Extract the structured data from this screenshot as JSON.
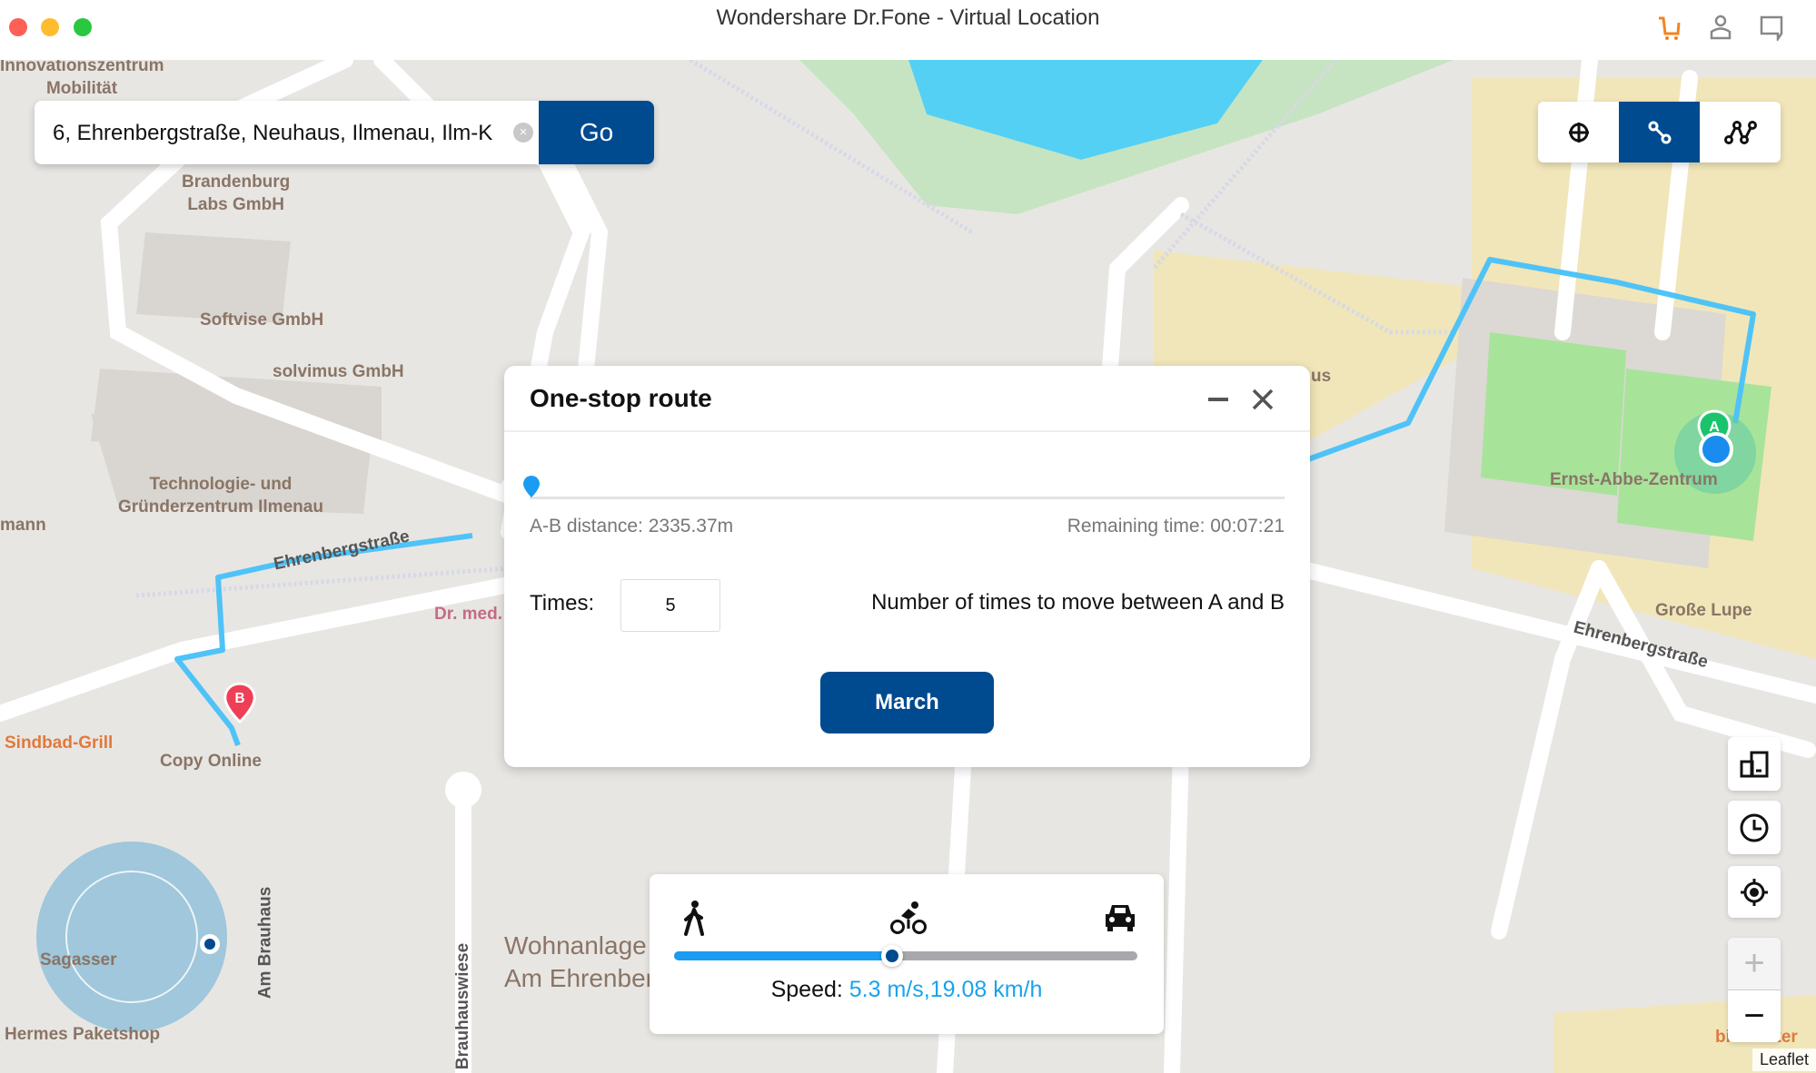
{
  "window": {
    "title": "Wondershare Dr.Fone - Virtual Location"
  },
  "titlebar_icons": [
    "cart-icon",
    "account-icon",
    "feedback-icon"
  ],
  "colors": {
    "brand": "#004a8f",
    "accent_blue": "#1a9cf2",
    "cart": "#f58220",
    "route": "#4fc3f7"
  },
  "search": {
    "value": "6, Ehrenbergstraße, Neuhaus, Ilmenau, Ilm-K",
    "go_label": "Go"
  },
  "modes": [
    {
      "name": "teleport-mode",
      "active": false
    },
    {
      "name": "one-stop-route-mode",
      "active": true
    },
    {
      "name": "multi-stop-route-mode",
      "active": false
    }
  ],
  "dialog": {
    "title": "One-stop route",
    "progress": 0,
    "distance": "A-B distance: 2335.37m",
    "remaining": "Remaining time: 00:07:21",
    "times_label": "Times:",
    "times_value": "5",
    "times_desc": "Number of times to move between A and B",
    "march_label": "March"
  },
  "speed": {
    "label": "Speed: ",
    "value": "5.3 m/s,19.08 km/h",
    "level": 0.47,
    "modes": [
      "walk",
      "bike",
      "car"
    ]
  },
  "map_controls": {
    "zoom_in": "+",
    "zoom_out": "−",
    "attribution": "Leaflet"
  },
  "map_labels": {
    "l1": "Innovationszentrum\nMobilität",
    "l2": "Brandenburg\nLabs GmbH",
    "l3": "Softvise GmbH",
    "l4": "solvimus GmbH",
    "l5": "Technologie- und\nGründerzentrum Ilmenau",
    "l6": "mann",
    "l7": "Ehrenbergstraße",
    "l8": "Dr. med.",
    "l9": "Sindbad-Grill",
    "l10": "Copy Online",
    "l11": "Sagasser",
    "l12": "Hermes Paketshop",
    "l13": "Am Brauhaus",
    "l14": "Brauhauswiese",
    "l15": "Wohnanlage\nAm Ehrenberg",
    "l16": "Ernst-Abbe-Zentrum",
    "l17": "Große Lupe",
    "l18": "Ehrenbergstraße",
    "l19": "us",
    "l20": "bierzenter"
  },
  "markers": {
    "a": "A",
    "b": "B"
  }
}
